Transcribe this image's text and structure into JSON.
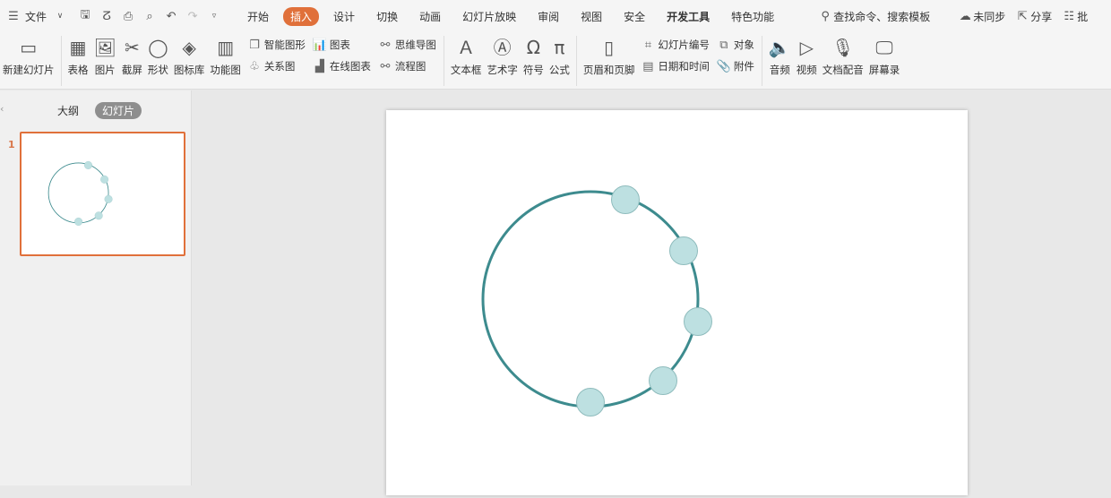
{
  "menubar": {
    "file": "文件",
    "tabs": [
      "开始",
      "插入",
      "设计",
      "切换",
      "动画",
      "幻灯片放映",
      "审阅",
      "视图",
      "安全",
      "开发工具",
      "特色功能"
    ],
    "search": "查找命令、搜索模板",
    "sync": "未同步",
    "share": "分享",
    "comment": "批"
  },
  "ribbon": {
    "new_slide": "新建幻灯片",
    "table": "表格",
    "picture": "图片",
    "screenshot": "截屏",
    "shape": "形状",
    "icon_lib": "图标库",
    "func_chart": "功能图",
    "smart_art": "智能图形",
    "relation": "关系图",
    "chart": "图表",
    "online_chart": "在线图表",
    "mindmap": "思维导图",
    "flowchart": "流程图",
    "textbox": "文本框",
    "wordart": "艺术字",
    "symbol": "符号",
    "formula": "公式",
    "header_footer": "页眉和页脚",
    "slide_num": "幻灯片编号",
    "datetime": "日期和时间",
    "object": "对象",
    "attachment": "附件",
    "audio": "音频",
    "video": "视频",
    "narration": "文档配音",
    "screen_rec": "屏幕录"
  },
  "left_panel": {
    "tabs": [
      "大纲",
      "幻灯片"
    ],
    "slide_number": "1"
  },
  "slide": {
    "stroke": "#3d8b8e",
    "fill": "#bde0e1"
  }
}
